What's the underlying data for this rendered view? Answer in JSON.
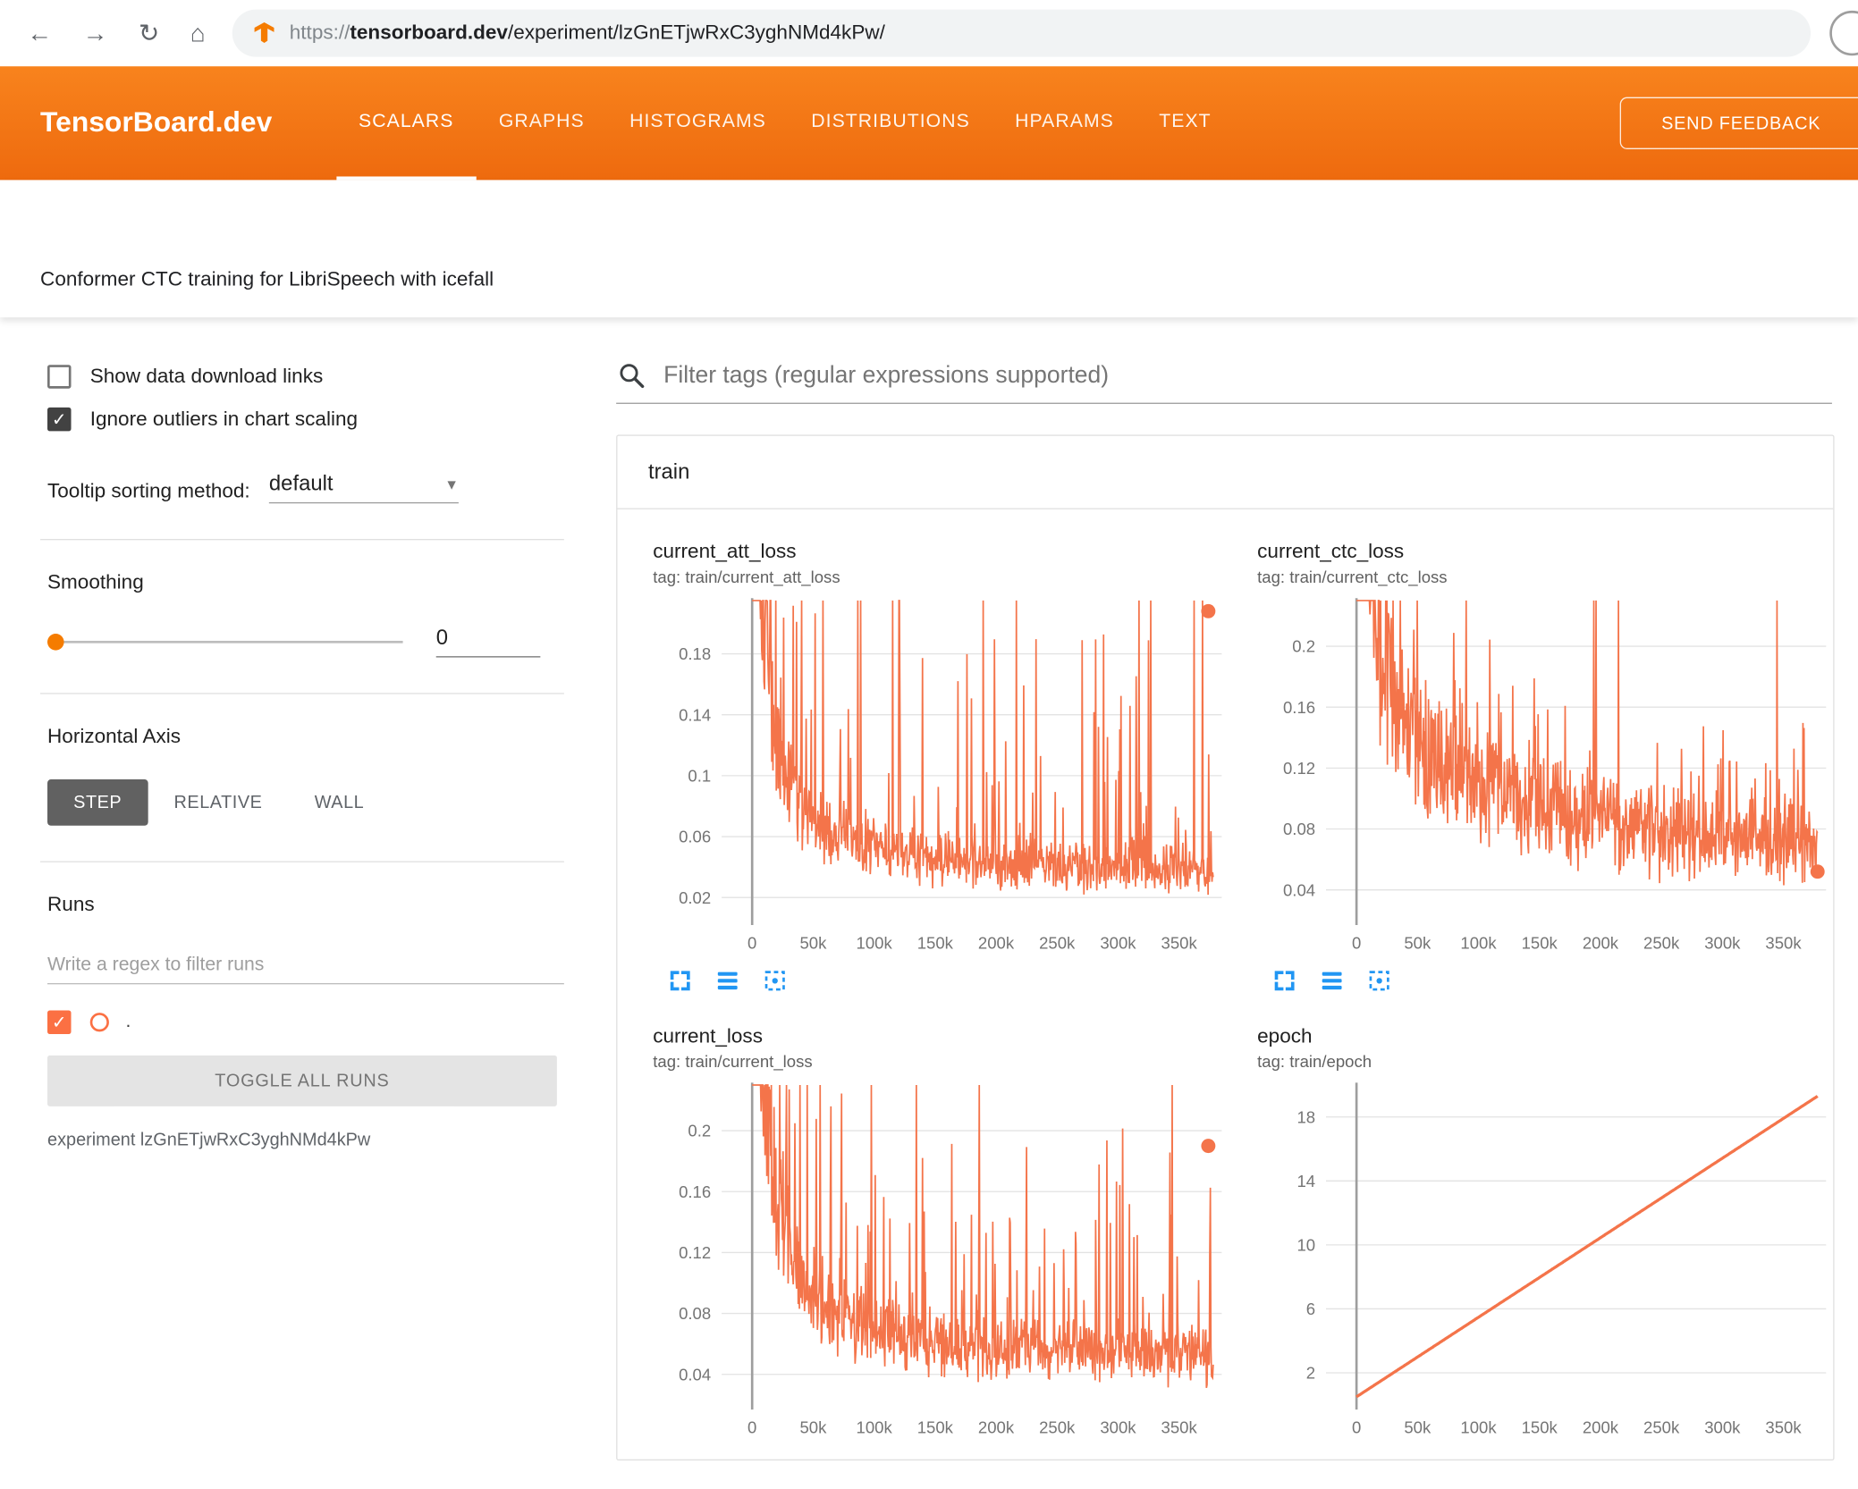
{
  "browser": {
    "url_scheme": "https://",
    "url_host": "tensorboard.dev",
    "url_path": "/experiment/lzGnETjwRxC3yghNMd4kPw/"
  },
  "icons": {
    "back": "←",
    "forward": "→",
    "reload": "↻",
    "home": "⌂",
    "check": "✓",
    "caret_down": "▼"
  },
  "header": {
    "logo": "TensorBoard.dev",
    "tabs": [
      {
        "label": "SCALARS",
        "active": true
      },
      {
        "label": "GRAPHS",
        "active": false
      },
      {
        "label": "HISTOGRAMS",
        "active": false
      },
      {
        "label": "DISTRIBUTIONS",
        "active": false
      },
      {
        "label": "HPARAMS",
        "active": false
      },
      {
        "label": "TEXT",
        "active": false
      }
    ],
    "feedback_button": "SEND FEEDBACK"
  },
  "experiment_bar": {
    "title": "Conformer CTC training for LibriSpeech with icefall"
  },
  "sidebar": {
    "show_download": {
      "label": "Show data download links",
      "checked": false
    },
    "ignore_outliers": {
      "label": "Ignore outliers in chart scaling",
      "checked": true
    },
    "tooltip_sort": {
      "label": "Tooltip sorting method:",
      "value": "default"
    },
    "smoothing": {
      "label": "Smoothing",
      "value": "0"
    },
    "horizontal_axis": {
      "label": "Horizontal Axis",
      "options": [
        "STEP",
        "RELATIVE",
        "WALL"
      ],
      "selected": "STEP"
    },
    "runs": {
      "label": "Runs",
      "filter_placeholder": "Write a regex to filter runs",
      "run_name": ".",
      "run_checked": true,
      "toggle_button": "TOGGLE ALL RUNS",
      "experiment_note": "experiment lzGnETjwRxC3yghNMd4kPw"
    }
  },
  "main": {
    "filter_placeholder": "Filter tags (regular expressions supported)",
    "section_label": "train"
  },
  "colors": {
    "header_orange": "#f1731a",
    "series_orange": "#f4744a",
    "run_swatch": "#fb7043",
    "icon_blue": "#2196f3",
    "slider_thumb": "#f57c00"
  },
  "chart_data": [
    {
      "id": "current_att_loss",
      "type": "line",
      "title": "current_att_loss",
      "tag": "tag: train/current_att_loss",
      "color": "#f4744a",
      "stroke_width": 1.3,
      "x_ticks": {
        "values": [
          0,
          50000,
          100000,
          150000,
          200000,
          250000,
          300000,
          350000
        ],
        "labels": [
          "0",
          "50k",
          "100k",
          "150k",
          "200k",
          "250k",
          "300k",
          "350k"
        ]
      },
      "y_ticks": {
        "values": [
          0.02,
          0.06,
          0.1,
          0.14,
          0.18
        ],
        "labels": [
          "0.02",
          "0.06",
          "0.1",
          "0.14",
          "0.18"
        ]
      },
      "xlim": [
        -25000,
        385000
      ],
      "ylim": [
        0.005,
        0.215
      ],
      "x_data_range": [
        0,
        378000
      ],
      "trend": [
        [
          0,
          0.5
        ],
        [
          8000,
          0.22
        ],
        [
          20000,
          0.11
        ],
        [
          40000,
          0.07
        ],
        [
          70000,
          0.05
        ],
        [
          120000,
          0.038
        ],
        [
          200000,
          0.031
        ],
        [
          378000,
          0.028
        ]
      ],
      "noise": 0.02,
      "spike": 0.165,
      "spike_prob": 0.13,
      "seed": 11,
      "end_dot": {
        "x": 374000,
        "y": 0.208
      },
      "toolbar": true
    },
    {
      "id": "current_ctc_loss",
      "type": "line",
      "title": "current_ctc_loss",
      "tag": "tag: train/current_ctc_loss",
      "color": "#f4744a",
      "stroke_width": 1.3,
      "x_ticks": {
        "values": [
          0,
          50000,
          100000,
          150000,
          200000,
          250000,
          300000,
          350000
        ],
        "labels": [
          "0",
          "50k",
          "100k",
          "150k",
          "200k",
          "250k",
          "300k",
          "350k"
        ]
      },
      "y_ticks": {
        "values": [
          0.04,
          0.08,
          0.12,
          0.16,
          0.2
        ],
        "labels": [
          "0.04",
          "0.08",
          "0.12",
          "0.16",
          "0.2"
        ]
      },
      "xlim": [
        -25000,
        385000
      ],
      "ylim": [
        0.02,
        0.23
      ],
      "x_data_range": [
        0,
        378000
      ],
      "trend": [
        [
          0,
          0.55
        ],
        [
          8000,
          0.3
        ],
        [
          20000,
          0.18
        ],
        [
          40000,
          0.13
        ],
        [
          80000,
          0.1
        ],
        [
          150000,
          0.08
        ],
        [
          250000,
          0.062
        ],
        [
          378000,
          0.054
        ]
      ],
      "noise": 0.03,
      "spike": 0.1,
      "spike_prob": 0.14,
      "seed": 23,
      "end_dot": {
        "x": 378000,
        "y": 0.052
      },
      "toolbar": true
    },
    {
      "id": "current_loss",
      "type": "line",
      "title": "current_loss",
      "tag": "tag: train/current_loss",
      "color": "#f4744a",
      "stroke_width": 1.3,
      "x_ticks": {
        "values": [
          0,
          50000,
          100000,
          150000,
          200000,
          250000,
          300000,
          350000
        ],
        "labels": [
          "0",
          "50k",
          "100k",
          "150k",
          "200k",
          "250k",
          "300k",
          "350k"
        ]
      },
      "y_ticks": {
        "values": [
          0.04,
          0.08,
          0.12,
          0.16,
          0.2
        ],
        "labels": [
          "0.04",
          "0.08",
          "0.12",
          "0.16",
          "0.2"
        ]
      },
      "xlim": [
        -25000,
        385000
      ],
      "ylim": [
        0.02,
        0.23
      ],
      "x_data_range": [
        0,
        378000
      ],
      "trend": [
        [
          0,
          0.55
        ],
        [
          8000,
          0.26
        ],
        [
          20000,
          0.14
        ],
        [
          40000,
          0.09
        ],
        [
          70000,
          0.068
        ],
        [
          120000,
          0.054
        ],
        [
          200000,
          0.045
        ],
        [
          378000,
          0.042
        ]
      ],
      "noise": 0.022,
      "spike": 0.15,
      "spike_prob": 0.13,
      "seed": 5,
      "end_dot": {
        "x": 374000,
        "y": 0.19
      },
      "toolbar": false
    },
    {
      "id": "epoch",
      "type": "line",
      "title": "epoch",
      "tag": "tag: train/epoch",
      "color": "#f4744a",
      "stroke_width": 2.5,
      "x_ticks": {
        "values": [
          0,
          50000,
          100000,
          150000,
          200000,
          250000,
          300000,
          350000
        ],
        "labels": [
          "0",
          "50k",
          "100k",
          "150k",
          "200k",
          "250k",
          "300k",
          "350k"
        ]
      },
      "y_ticks": {
        "values": [
          2,
          6,
          10,
          14,
          18
        ],
        "labels": [
          "2",
          "6",
          "10",
          "14",
          "18"
        ]
      },
      "xlim": [
        -25000,
        385000
      ],
      "ylim": [
        0,
        20
      ],
      "x_data_range": [
        0,
        378000
      ],
      "trend": [
        [
          0,
          0.5
        ],
        [
          378000,
          19.3
        ]
      ],
      "noise": 0,
      "spike": 0,
      "spike_prob": 0,
      "seed": 1,
      "end_dot": null,
      "toolbar": false
    }
  ]
}
